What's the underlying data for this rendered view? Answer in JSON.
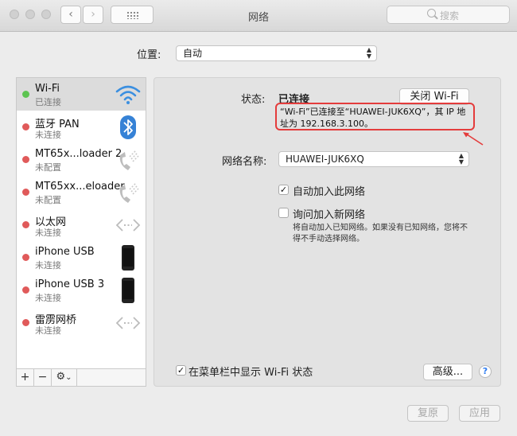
{
  "window": {
    "title": "网络"
  },
  "toolbar": {
    "back": "‹",
    "forward": "›",
    "search_placeholder": "搜索"
  },
  "location": {
    "label": "位置:",
    "value": "自动"
  },
  "services": [
    {
      "name": "Wi-Fi",
      "status": "已连接",
      "dot_color": "#5dc451",
      "icon": "wifi-icon",
      "selected": true
    },
    {
      "name": "蓝牙 PAN",
      "status": "未连接",
      "dot_color": "#e05a5a",
      "icon": "bluetooth-icon"
    },
    {
      "name": "MT65x...loader 2",
      "status": "未配置",
      "dot_color": "#e05a5a",
      "icon": "phone-handset-icon"
    },
    {
      "name": "MT65xx...eloader",
      "status": "未配置",
      "dot_color": "#e05a5a",
      "icon": "phone-handset-icon"
    },
    {
      "name": "以太网",
      "status": "未连接",
      "dot_color": "#e05a5a",
      "icon": "ethernet-icon"
    },
    {
      "name": "iPhone USB",
      "status": "未连接",
      "dot_color": "#e05a5a",
      "icon": "iphone-icon"
    },
    {
      "name": "iPhone USB 3",
      "status": "未连接",
      "dot_color": "#e05a5a",
      "icon": "iphone-icon"
    },
    {
      "name": "雷雳网桥",
      "status": "未连接",
      "dot_color": "#e05a5a",
      "icon": "thunderbolt-bridge-icon"
    }
  ],
  "sidebar_toolbar": {
    "add": "+",
    "remove": "−",
    "gear": "⚙",
    "gear_caret": "⌄"
  },
  "detail": {
    "status_label": "状态:",
    "status_value": "已连接",
    "toggle_button": "关闭 Wi-Fi",
    "status_description": "“Wi-Fi”已连接至“HUAWEI-JUK6XQ”，其 IP 地址为 192.168.3.100。",
    "network_name_label": "网络名称:",
    "network_name_value": "HUAWEI-JUK6XQ",
    "auto_join_label": "自动加入此网络",
    "auto_join_checked": true,
    "ask_join_label": "询问加入新网络",
    "ask_join_checked": false,
    "ask_join_note": "将自动加入已知网络。如果没有已知网络，您将不得不手动选择网络。",
    "show_menubar_label": "在菜单栏中显示 Wi-Fi 状态",
    "show_menubar_checked": true,
    "advanced_button": "高级...",
    "help": "?"
  },
  "footer": {
    "revert_button": "复原",
    "apply_button": "应用"
  },
  "colors": {
    "annotation_red": "#e43c3c",
    "connected_green": "#5dc451",
    "disconnected_red": "#e05a5a",
    "accent_blue": "#2f7cf0"
  }
}
